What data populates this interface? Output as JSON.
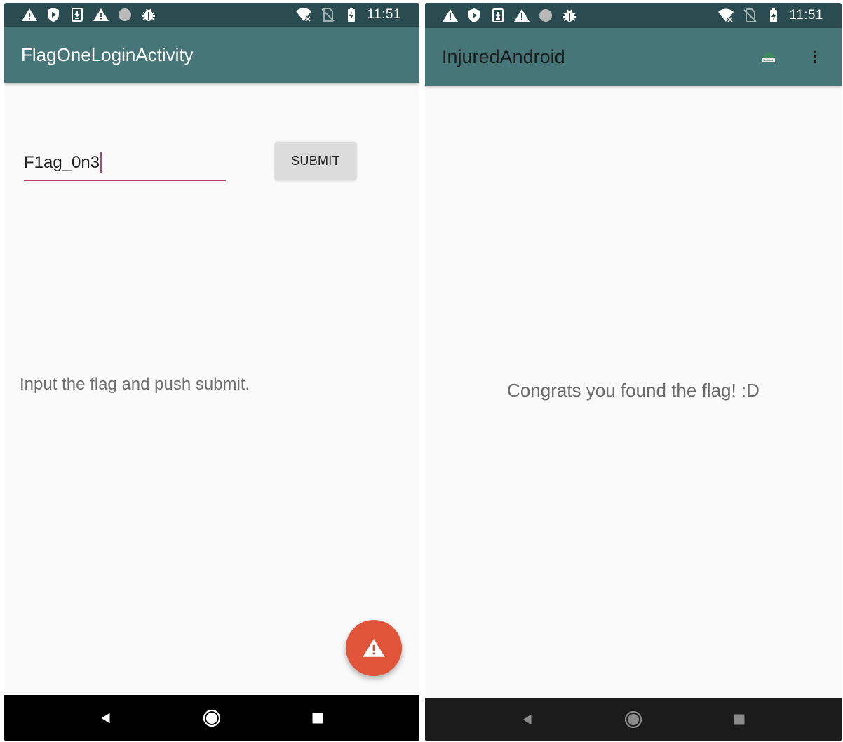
{
  "colors": {
    "status_bar": "#2a4b4f",
    "app_bar": "#467678",
    "accent_pink": "#b0466a",
    "fab": "#e0553a",
    "background": "#fafafa"
  },
  "left_screen": {
    "status": {
      "time": "11:51",
      "icons": [
        "warning-icon",
        "shield-play-icon",
        "download-icon",
        "warning-icon",
        "circle-icon",
        "bug-icon"
      ],
      "right_icons": [
        "wifi-off-icon",
        "no-sim-icon",
        "battery-charging-icon"
      ]
    },
    "app_bar": {
      "title": "FlagOneLoginActivity"
    },
    "flag_input": {
      "value": "F1ag_0n3"
    },
    "submit_button": {
      "label": "SUBMIT"
    },
    "instructions": "Input the flag and push submit.",
    "fab": {
      "icon": "warning-icon"
    },
    "nav": [
      "back-icon",
      "home-icon",
      "recents-icon"
    ]
  },
  "right_screen": {
    "status": {
      "time": "11:51",
      "icons": [
        "warning-icon",
        "shield-play-icon",
        "download-icon",
        "warning-icon",
        "circle-icon",
        "bug-icon"
      ],
      "right_icons": [
        "wifi-off-icon",
        "no-sim-icon",
        "battery-charging-icon"
      ]
    },
    "app_bar": {
      "title": "InjuredAndroid",
      "actions": [
        "app-logo-icon",
        "overflow-menu-icon"
      ]
    },
    "message": "Congrats you found the flag! :D",
    "nav": [
      "back-icon",
      "home-icon",
      "recents-icon"
    ]
  }
}
